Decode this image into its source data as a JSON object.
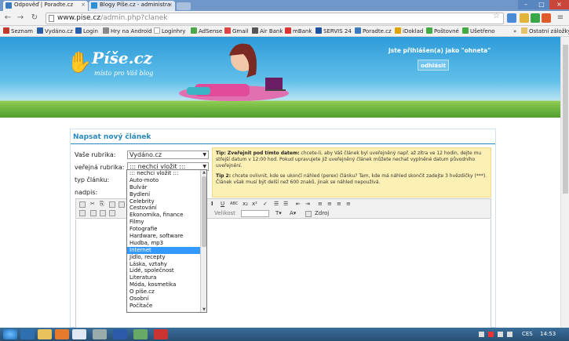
{
  "browser": {
    "tabs": [
      {
        "title": "Odpověď | Poradte.cz"
      },
      {
        "title": "Blogy Píše.cz - administra"
      }
    ],
    "address": {
      "host": "www.pise.cz",
      "path": "/admin.php?clanek"
    },
    "bookmarks": [
      {
        "label": "Seznam",
        "color": "#c0392b"
      },
      {
        "label": "Vydáno.cz",
        "color": "#2a5ea8"
      },
      {
        "label": "Login",
        "color": "#2a5ea8"
      },
      {
        "label": "Hry na Android",
        "color": "#888"
      },
      {
        "label": "Loginhry",
        "color": "#fff"
      },
      {
        "label": "AdSense",
        "color": "#4aa84a"
      },
      {
        "label": "Gmail",
        "color": "#d44"
      },
      {
        "label": "Air Bank",
        "color": "#555"
      },
      {
        "label": "mBank",
        "color": "#d33"
      },
      {
        "label": "SERVIS 24",
        "color": "#1c4ea1"
      },
      {
        "label": "Poradte.cz",
        "color": "#3a7bc0"
      },
      {
        "label": "iDoklad",
        "color": "#e0a400"
      },
      {
        "label": "Poštovné",
        "color": "#4a4"
      },
      {
        "label": "Ušetřeno",
        "color": "#4a4"
      },
      {
        "label": "Ostatní záložky",
        "color": "#e3c26a"
      }
    ],
    "bookmarks_overflow": "»"
  },
  "header": {
    "logo": "Píše.cz",
    "tagline": "místo pro Váš blog",
    "login_status": "Jste přihlášen(a) jako \"ohneta\"",
    "logout_label": "odhlásit"
  },
  "form": {
    "title": "Napsat nový článek",
    "rubrika_label": "Vaše rubrika:",
    "rubrika_value": "Vydáno.cz",
    "verejna_label": "veřejná rubrika:",
    "verejna_value": "::: nechci vložit :::",
    "typ_label": "typ článku:",
    "nadpis_label": "nadpis:",
    "tip1_bold": "Tip: Zveřejnit pod tímto datem:",
    "tip1_text": " chcete-li, aby Váš článek byl uveřejněný např. až zítra ve 12 hodin, dejte mu střejší datum v 12:00 hod. Pokud upravujete již uveřejněný článek můžete nechat vyplněné datum původního uveřejnění.",
    "tip2_bold": "Tip 2:",
    "tip2_text": " chcete ovlivnit, kde se ukončí náhled (perex) článku? Tam, kde má náhled skončit zadejte 3 hvězdičky (***). Článek však musí být delší než 600 znaků, jinak se náhled nepoužívá.",
    "editor": {
      "size_label": "Velikost",
      "source_label": "Zdroj"
    }
  },
  "dropdown": {
    "options": [
      "::: nechci vložit :::",
      "Auto-moto",
      "Bulvár",
      "Bydlení",
      "Celebrity",
      "Cestování",
      "Ekonomika, finance",
      "Filmy",
      "Fotografie",
      "Hardware, software",
      "Hudba, mp3",
      "Internet",
      "Jídlo, recepty",
      "Láska, vztahy",
      "Lidé, společnost",
      "Literatura",
      "Móda, kosmetika",
      "O píše.cz",
      "Osobní",
      "Počítače"
    ],
    "highlighted": "Internet"
  },
  "taskbar": {
    "lang": "CES",
    "clock": "14:53"
  }
}
